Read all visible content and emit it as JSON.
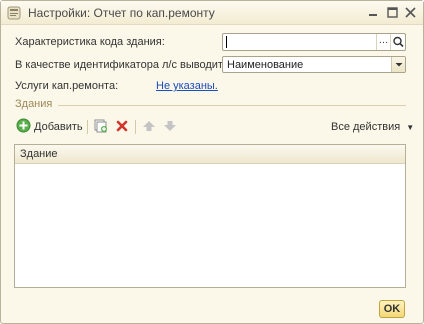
{
  "window": {
    "title": "Настройки: Отчет по кап.ремонту"
  },
  "form": {
    "building_code_label": "Характеристика кода здания:",
    "identifier_label": "В качестве идентификатора л/с выводить:",
    "identifier_value": "Наименование",
    "services_label": "Услуги кап.ремонта:",
    "services_link": "Не указаны."
  },
  "buildings_group": {
    "title": "Здания",
    "toolbar": {
      "add_label": "Добавить",
      "all_actions_label": "Все действия"
    },
    "table": {
      "columns": [
        "Здание"
      ],
      "rows": []
    }
  },
  "footer": {
    "ok_label": "OK"
  },
  "icons": {
    "title": "report-icon",
    "select": "ellipsis-icon",
    "search": "magnifier-icon",
    "add": "add-circle-icon",
    "copy": "copy-icon",
    "delete": "delete-icon",
    "move_up": "arrow-up-icon",
    "move_down": "arrow-down-icon"
  },
  "colors": {
    "window_bg": "#fbf7e9",
    "link": "#1b4cc0",
    "group_label": "#9d8a5b",
    "ok_bg": "#f3d776"
  }
}
